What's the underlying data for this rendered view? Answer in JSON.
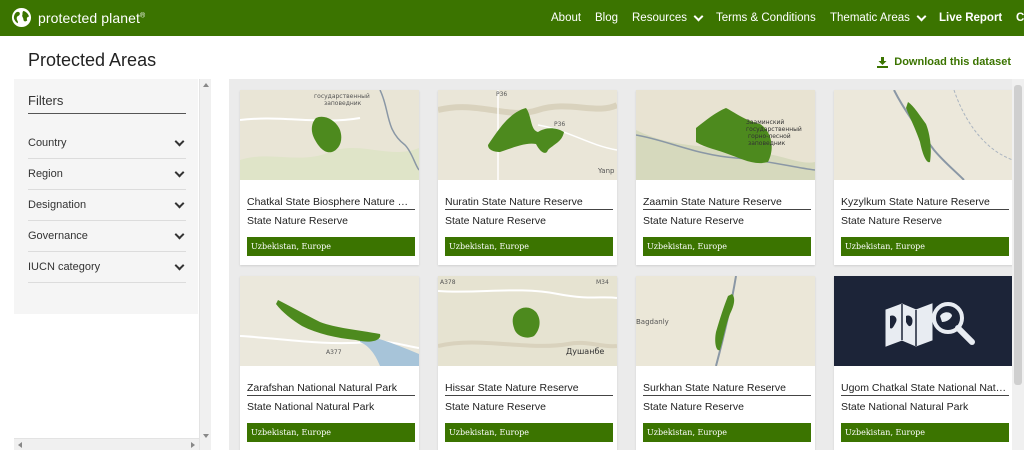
{
  "header": {
    "logo_text": "protected planet",
    "logo_mark": "®",
    "nav": [
      {
        "label": "About"
      },
      {
        "label": "Blog"
      },
      {
        "label": "Resources"
      },
      {
        "label": "Terms & Conditions"
      },
      {
        "label": "Thematic Areas"
      },
      {
        "label": "Live Report"
      },
      {
        "label": "C"
      }
    ],
    "color": "#3b7400"
  },
  "page": {
    "title": "Protected Areas",
    "download_label": "Download this dataset"
  },
  "filters": {
    "title": "Filters",
    "items": [
      {
        "label": "Country"
      },
      {
        "label": "Region"
      },
      {
        "label": "Designation"
      },
      {
        "label": "Governance"
      },
      {
        "label": "IUCN category"
      }
    ]
  },
  "cards": [
    {
      "name": "Chatkal State Biosphere Nature R…",
      "designation": "State Nature Reserve",
      "location": "Uzbekistan, Europe",
      "map_labels": [
        "государственный",
        "заповедник"
      ]
    },
    {
      "name": "Nuratin State Nature Reserve",
      "designation": "State Nature Reserve",
      "location": "Uzbekistan, Europe",
      "map_labels": [
        "P36",
        "P36",
        "Yanp"
      ]
    },
    {
      "name": "Zaamin State Nature Reserve",
      "designation": "State Nature Reserve",
      "location": "Uzbekistan, Europe",
      "map_labels": [
        "Зааминский",
        "государственный",
        "горно-лесной",
        "заповедник"
      ]
    },
    {
      "name": "Kyzylkum State Nature Reserve",
      "designation": "State Nature Reserve",
      "location": "Uzbekistan, Europe",
      "map_labels": []
    },
    {
      "name": "Zarafshan National Natural Park",
      "designation": "State National Natural Park",
      "location": "Uzbekistan, Europe",
      "map_labels": [
        "A377"
      ]
    },
    {
      "name": "Hissar State Nature Reserve",
      "designation": "State Nature Reserve",
      "location": "Uzbekistan, Europe",
      "map_labels": [
        "A378",
        "M34",
        "Душанбе"
      ]
    },
    {
      "name": "Surkhan State Nature Reserve",
      "designation": "State Nature Reserve",
      "location": "Uzbekistan, Europe",
      "map_labels": [
        "Bagdanly"
      ]
    },
    {
      "name": "Ugom Chatkal State National Nat…",
      "designation": "State National Natural Park",
      "location": "Uzbekistan, Europe",
      "map_labels": []
    }
  ]
}
